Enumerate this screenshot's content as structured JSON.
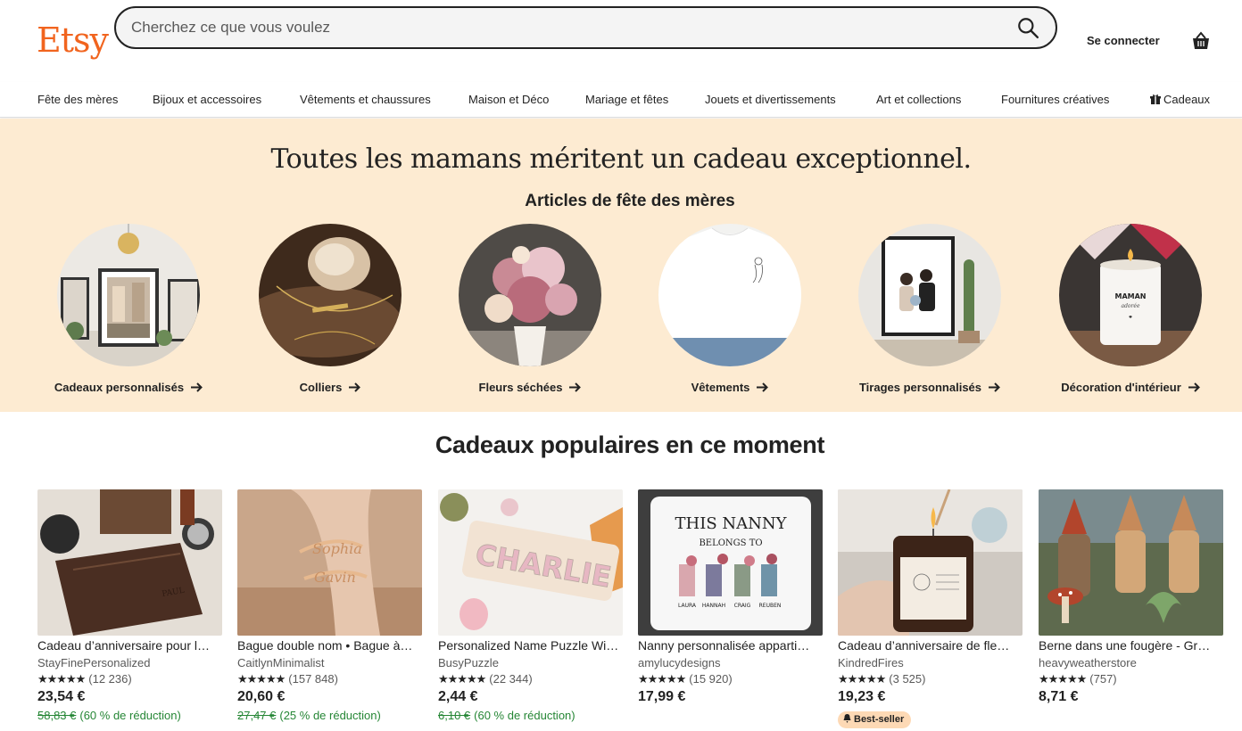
{
  "header": {
    "logo": "Etsy",
    "search_placeholder": "Cherchez ce que vous voulez",
    "signin": "Se connecter"
  },
  "nav": [
    "Fête des mères",
    "Bijoux et accessoires",
    "Vêtements et chaussures",
    "Maison et Déco",
    "Mariage et fêtes",
    "Jouets et divertissements",
    "Art et collections",
    "Fournitures créatives",
    "Cadeaux"
  ],
  "hero": {
    "title": "Toutes les mamans méritent un cadeau exceptionnel.",
    "subtitle": "Articles de fête des mères",
    "categories": [
      "Cadeaux personnalisés",
      "Colliers",
      "Fleurs séchées",
      "Vêtements",
      "Tirages personnalisés",
      "Décoration d'intérieur"
    ]
  },
  "popular": {
    "title": "Cadeaux populaires en ce moment",
    "stars": "★★★★★",
    "items": [
      {
        "title": "Cadeau d’anniversaire pour l…",
        "shop": "StayFinePersonalized",
        "reviews": "(12 236)",
        "price": "23,54 €",
        "original": "58,83 €",
        "discount": "(60 % de réduction)"
      },
      {
        "title": "Bague double nom • Bague à…",
        "shop": "CaitlynMinimalist",
        "reviews": "(157 848)",
        "price": "20,60 €",
        "original": "27,47 €",
        "discount": "(25 % de réduction)"
      },
      {
        "title": "Personalized Name Puzzle Wi…",
        "shop": "BusyPuzzle",
        "reviews": "(22 344)",
        "price": "2,44 €",
        "original": "6,10 €",
        "discount": "(60 % de réduction)"
      },
      {
        "title": "Nanny personnalisée apparti…",
        "shop": "amylucydesigns",
        "reviews": "(15 920)",
        "price": "17,99 €"
      },
      {
        "title": "Cadeau d’anniversaire de fle…",
        "shop": "KindredFires",
        "reviews": "(3 525)",
        "price": "19,23 €",
        "badge": "Best-seller"
      },
      {
        "title": "Berne dans une fougère - Gr…",
        "shop": "heavyweatherstore",
        "reviews": "(757)",
        "price": "8,71 €"
      }
    ],
    "pillow_text": {
      "line1": "THIS NANNY",
      "line2": "BELONGS TO",
      "names": [
        "LAURA",
        "HANNAH",
        "CRAIG",
        "REUBEN"
      ]
    },
    "puzzle_text": "CHARLIE",
    "candle_text": {
      "line1": "MAMAN",
      "line2": "adorée"
    }
  },
  "colors": {
    "brand": "#F1641E",
    "hero_bg": "#FDEBD2",
    "discount": "#258635",
    "badge": "#FDD9B5"
  }
}
